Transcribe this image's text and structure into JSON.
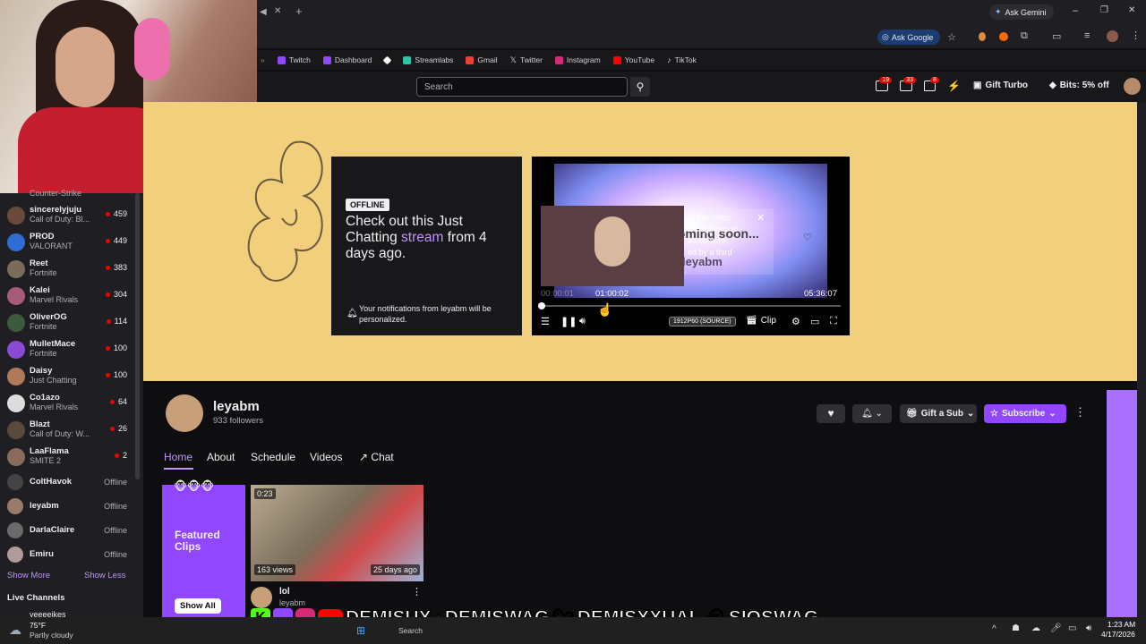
{
  "browser": {
    "ask_gemini": "Ask Gemini",
    "ask_google": "Ask Google",
    "bookmarks": [
      {
        "label": "Twitch",
        "color": "#9146ff"
      },
      {
        "label": "Dashboard",
        "color": "#9146ff"
      },
      {
        "label": "",
        "color": "#ffffff"
      },
      {
        "label": "Streamlabs",
        "color": "#31c3a2"
      },
      {
        "label": "Gmail",
        "color": "#ea4335"
      },
      {
        "label": "Twitter",
        "color": "#ffffff"
      },
      {
        "label": "Instagram",
        "color": "#d62976"
      },
      {
        "label": "YouTube",
        "color": "#ff0000"
      },
      {
        "label": "TikTok",
        "color": "#ffffff"
      }
    ]
  },
  "topnav": {
    "search_placeholder": "Search",
    "badge_inbox": "19",
    "badge_whispers": "33",
    "badge_notifications": "8",
    "gift_turbo": "Gift Turbo",
    "bits_offer": "Bits: 5% off"
  },
  "sidebar": {
    "partial_top": "Counter-Strike",
    "channels": [
      {
        "name": "sincerelyjuju",
        "game": "Call of Duty: Bl...",
        "viewers": "459",
        "color": "#6b4a3c"
      },
      {
        "name": "PROD",
        "game": "VALORANT",
        "viewers": "449",
        "color": "#2f6dd6"
      },
      {
        "name": "Reet",
        "game": "Fortnite",
        "viewers": "383",
        "color": "#7a6b5a"
      },
      {
        "name": "Kalei",
        "game": "Marvel Rivals",
        "viewers": "304",
        "color": "#a85a7a"
      },
      {
        "name": "OliverOG",
        "game": "Fortnite",
        "viewers": "114",
        "color": "#3c5a3c"
      },
      {
        "name": "MulletMace",
        "game": "Fortnite",
        "viewers": "100",
        "color": "#8a4ad6"
      },
      {
        "name": "Daisy",
        "game": "Just Chatting",
        "viewers": "100",
        "color": "#b07a5a"
      },
      {
        "name": "Co1azo",
        "game": "Marvel Rivals",
        "viewers": "64",
        "color": "#dcdcdc"
      },
      {
        "name": "Blazt",
        "game": "Call of Duty: W...",
        "viewers": "26",
        "color": "#5a4a3c"
      },
      {
        "name": "LaaFlama",
        "game": "SMITE 2",
        "viewers": "2",
        "color": "#8a6a5a"
      }
    ],
    "offline": [
      {
        "name": "ColtHavok",
        "status": "Offline",
        "color": "#444"
      },
      {
        "name": "leyabm",
        "status": "Offline",
        "color": "#9a7a6a"
      },
      {
        "name": "DarlaClaire",
        "status": "Offline",
        "color": "#6a6a6a"
      },
      {
        "name": "Emiru",
        "status": "Offline",
        "color": "#b09a9a"
      }
    ],
    "show_more": "Show More",
    "show_less": "Show Less",
    "live_channels": "Live Channels",
    "partial_bottom": "yeeeeikes"
  },
  "offline_panel": {
    "badge": "OFFLINE",
    "headline_pre": "Check out this Just Chatting",
    "headline_link": "stream",
    "headline_post": "from 4 days ago.",
    "notification_text": "Your notifications from leyabm will be personalized."
  },
  "player": {
    "overlay_text": [
      "of this video",
      "s it appears to",
      "ed content",
      "ed by a third"
    ],
    "coming_soon": "coming soon...",
    "watermark": "leyabm",
    "time_hover": "01:00:02",
    "time_current": "00:00:01",
    "duration": "05:36:07",
    "quality": "1912P60 (SOURCE)",
    "clip": "Clip",
    "progress": 0.01
  },
  "channel": {
    "name": "leyabm",
    "followers": "933 followers",
    "gift_sub": "Gift a Sub",
    "subscribe": "Subscribe",
    "tabs": [
      "Home",
      "About",
      "Schedule",
      "Videos",
      "Chat"
    ],
    "featured_clips": "Featured Clips",
    "show_all": "Show All",
    "clip": {
      "duration": "0:23",
      "views": "163 views",
      "age": "25 days ago",
      "title": "lol",
      "channel": "leyabm"
    }
  },
  "social": {
    "handle1": "DEMISUX",
    "handle2": "DEMISWAG",
    "handle3": "DEMISXXUAL",
    "handle4": "SIOSWAG"
  },
  "taskbar": {
    "temp": "75°F",
    "weather": "Partly cloudy",
    "search": "Search",
    "time": "1:23 AM",
    "date": "4/17/2026"
  }
}
